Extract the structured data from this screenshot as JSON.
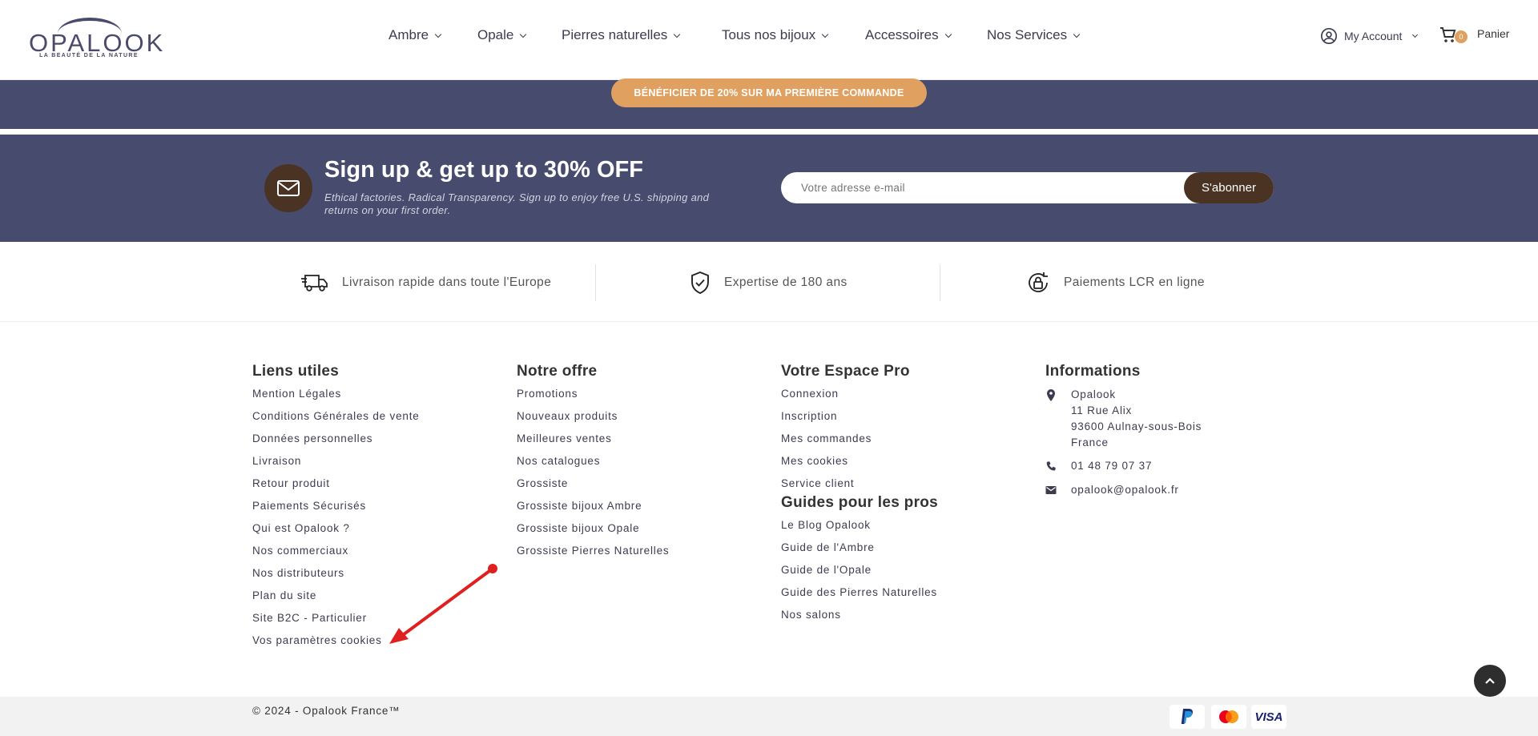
{
  "header": {
    "logo_text": "OPALOOK",
    "logo_tagline": "LA BEAUTÉ DE LA NATURE",
    "nav": [
      "Ambre",
      "Opale",
      "Pierres naturelles",
      "Tous nos bijoux",
      "Accessoires",
      "Nos Services"
    ],
    "account_label": "My Account",
    "cart_count": "0",
    "cart_label": "Panier"
  },
  "promo": {
    "button_label": "BÉNÉFICIER DE 20% SUR MA PREMIÈRE COMMANDE"
  },
  "newsletter": {
    "title": "Sign up & get up to 30% OFF",
    "subtitle": "Ethical factories. Radical Transparency. Sign up to enjoy free U.S. shipping and returns on your first order.",
    "input_placeholder": "Votre adresse e-mail",
    "button_label": "S'abonner"
  },
  "features": [
    {
      "icon": "truck-icon",
      "label": "Livraison rapide dans toute l'Europe"
    },
    {
      "icon": "shield-check-icon",
      "label": "Expertise de 180 ans"
    },
    {
      "icon": "lock-refresh-icon",
      "label": "Paiements LCR en ligne"
    }
  ],
  "footer": {
    "liens_utiles": {
      "title": "Liens utiles",
      "links": [
        "Mention Légales",
        "Conditions Générales de vente",
        "Données personnelles",
        "Livraison",
        "Retour produit",
        "Paiements Sécurisés",
        "Qui est Opalook ?",
        "Nos commerciaux",
        "Nos distributeurs",
        "Plan du site",
        "Site B2C - Particulier",
        "Vos paramètres cookies"
      ]
    },
    "notre_offre": {
      "title": "Notre offre",
      "links": [
        "Promotions",
        "Nouveaux produits",
        "Meilleures ventes",
        "Nos catalogues",
        "Grossiste",
        "Grossiste bijoux Ambre",
        "Grossiste bijoux Opale",
        "Grossiste Pierres Naturelles"
      ]
    },
    "espace_pro": {
      "title": "Votre Espace Pro",
      "links": [
        "Connexion",
        "Inscription",
        "Mes commandes",
        "Mes cookies",
        "Service client"
      ]
    },
    "guides": {
      "title": "Guides pour les pros",
      "links": [
        "Le Blog Opalook",
        "Guide de l'Ambre",
        "Guide de l'Opale",
        "Guide des Pierres Naturelles",
        "Nos salons"
      ]
    },
    "informations": {
      "title": "Informations",
      "address": [
        "Opalook",
        "11 Rue Alix",
        "93600 Aulnay-sous-Bois",
        "France"
      ],
      "phone": "01 48 79 07 37",
      "email": "opalook@opalook.fr"
    }
  },
  "bottom": {
    "copyright": "© 2024 - Opalook France™",
    "payments": [
      "PayPal",
      "Mastercard",
      "VISA"
    ]
  },
  "colors": {
    "navy_band": "#474b6e",
    "promo_orange": "#e0a060",
    "brown": "#4a3323",
    "annotation_red": "#e02020"
  }
}
